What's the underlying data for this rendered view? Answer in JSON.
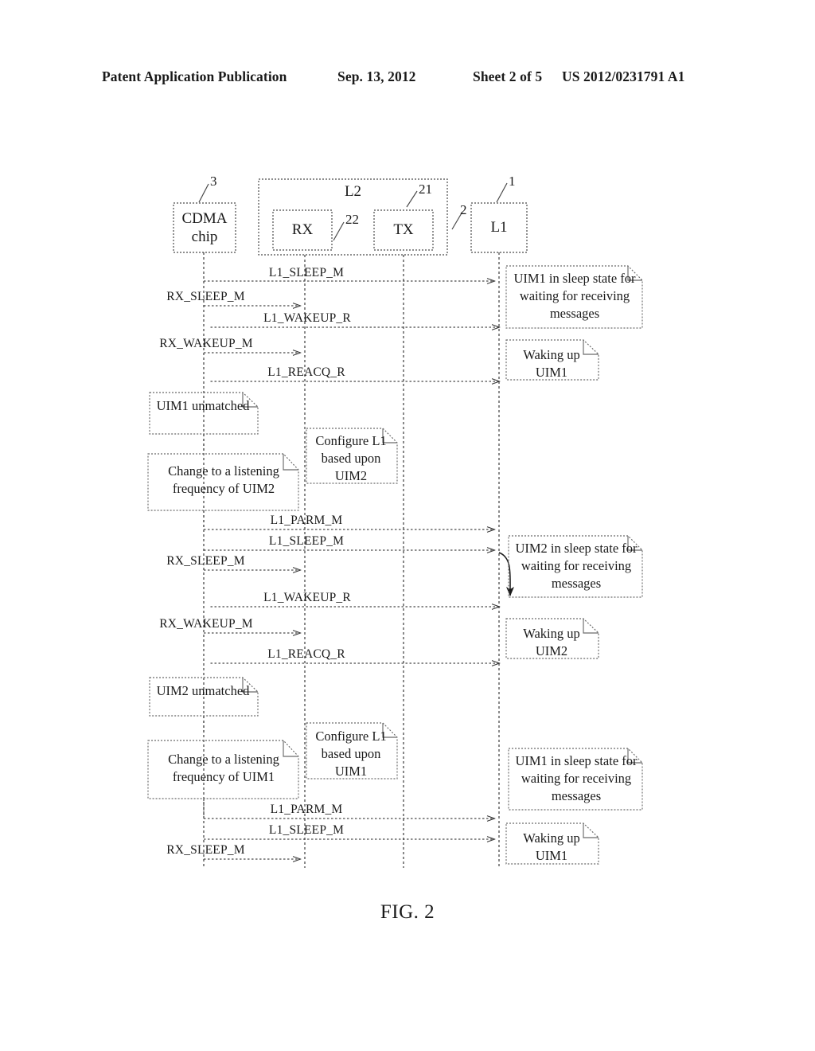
{
  "header": {
    "publication": "Patent Application Publication",
    "date": "Sep. 13, 2012",
    "sheet": "Sheet 2 of 5",
    "number": "US 2012/0231791 A1"
  },
  "figure": {
    "caption": "FIG. 2"
  },
  "participants": [
    {
      "id": "cdma",
      "label_line1": "CDMA",
      "label_line2": "chip",
      "ref": "3"
    },
    {
      "id": "rx",
      "label_line1": "RX",
      "label_line2": "",
      "ref": "22"
    },
    {
      "id": "tx",
      "label_line1": "TX",
      "label_line2": "",
      "ref": "21"
    },
    {
      "id": "l1",
      "label_line1": "L1",
      "label_line2": "",
      "ref": "1"
    }
  ],
  "container": {
    "label": "L2",
    "ref": "2"
  },
  "messages": [
    {
      "id": "m1",
      "label": "L1_SLEEP_M",
      "from": "rx",
      "to": "l1",
      "dir": "right"
    },
    {
      "id": "m2",
      "label": "RX_SLEEP_M",
      "from": "cdma",
      "to": "rx",
      "dir": "right"
    },
    {
      "id": "m3",
      "label": "L1_WAKEUP_R",
      "from": "l1",
      "to": "cdma",
      "dir": "left"
    },
    {
      "id": "m4",
      "label": "RX_WAKEUP_M",
      "from": "cdma",
      "to": "rx",
      "dir": "right"
    },
    {
      "id": "m5",
      "label": "L1_REACQ_R",
      "from": "l1",
      "to": "cdma",
      "dir": "left"
    },
    {
      "id": "m6",
      "label": "L1_PARM_M",
      "from": "rx",
      "to": "l1",
      "dir": "right"
    },
    {
      "id": "m7",
      "label": "L1_SLEEP_M",
      "from": "rx",
      "to": "l1",
      "dir": "right"
    },
    {
      "id": "m8",
      "label": "RX_SLEEP_M",
      "from": "cdma",
      "to": "rx",
      "dir": "right"
    },
    {
      "id": "m9",
      "label": "L1_WAKEUP_R",
      "from": "l1",
      "to": "cdma",
      "dir": "left"
    },
    {
      "id": "m10",
      "label": "RX_WAKEUP_M",
      "from": "cdma",
      "to": "rx",
      "dir": "right"
    },
    {
      "id": "m11",
      "label": "L1_REACQ_R",
      "from": "l1",
      "to": "cdma",
      "dir": "left"
    },
    {
      "id": "m12",
      "label": "L1_PARM_M",
      "from": "rx",
      "to": "l1",
      "dir": "right"
    },
    {
      "id": "m13",
      "label": "L1_SLEEP_M",
      "from": "rx",
      "to": "l1",
      "dir": "right"
    },
    {
      "id": "m14",
      "label": "RX_SLEEP_M",
      "from": "cdma",
      "to": "rx",
      "dir": "right"
    }
  ],
  "notes": [
    {
      "id": "n1",
      "text": "UIM1 in sleep state for waiting for receiving messages"
    },
    {
      "id": "n2",
      "text": "Waking up UIM1"
    },
    {
      "id": "n3",
      "text": "UIM1 unmatched"
    },
    {
      "id": "n4",
      "text": "Change to a listening frequency of UIM2"
    },
    {
      "id": "n5",
      "text": "Configure L1 based upon UIM2"
    },
    {
      "id": "n6",
      "text": "UIM2 in sleep state for waiting for receiving messages"
    },
    {
      "id": "n7",
      "text": "Waking up UIM2"
    },
    {
      "id": "n8",
      "text": "UIM2 unmatched"
    },
    {
      "id": "n9",
      "text": "Change to a listening frequency of UIM1"
    },
    {
      "id": "n10",
      "text": "Configure L1 based upon UIM1"
    },
    {
      "id": "n11",
      "text": "UIM1 in sleep state for waiting for receiving messages"
    },
    {
      "id": "n12",
      "text": "Waking up UIM1"
    }
  ],
  "colors": {
    "ink": "#1a1a1a",
    "line": "#555555",
    "paper": "#ffffff"
  }
}
